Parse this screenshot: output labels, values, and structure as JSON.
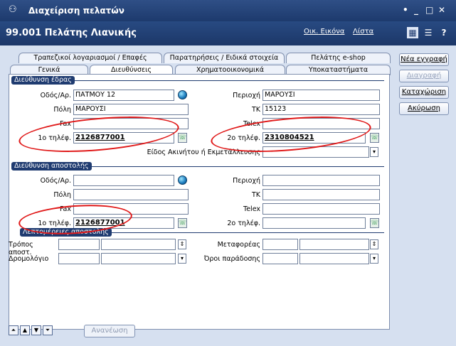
{
  "window": {
    "title": "Διαχείριση πελατών",
    "controls": [
      "•",
      "_",
      "□",
      "✕"
    ]
  },
  "header": {
    "title": "99.001 Πελάτης Λιανικής",
    "buttons": {
      "image": "Εικόνα",
      "list": "Λίστα"
    },
    "image_prefix": "Οικ."
  },
  "tabs_top": [
    "Τραπεζικοί λογαριασμοί / Επαφές",
    "Παρατηρήσεις / Ειδικά στοιχεία",
    "Πελάτης e-shop"
  ],
  "tabs_bottom": [
    "Γενικά",
    "Διευθύνσεις",
    "Χρηματοοικονομικά",
    "Υποκαταστήματα"
  ],
  "sections": {
    "seat": "Διεύθυνση έδρας",
    "shipping": "Διεύθυνση αποστολής",
    "shipping_details": "Λεπτομέρειες αποστολής"
  },
  "seat": {
    "street_label": "Οδός/Αρ.",
    "street_value": "ΠΑΤΜΟΥ 12",
    "area_label": "Περιοχή",
    "area_value": "ΜΑΡΟΥΣΙ",
    "city_label": "Πόλη",
    "city_value": "ΜΑΡΟΥΣΙ",
    "tk_label": "ΤΚ",
    "tk_value": "15123",
    "fax_label": "Fax",
    "telex_label": "Telex",
    "phone1_label": "1ο τηλέφ.",
    "phone1_value": "2126877001",
    "phone2_label": "2ο τηλέφ.",
    "phone2_value": "2310804521",
    "property_label": "Είδος Ακινήτου ή Εκμετάλλευσης"
  },
  "shipping": {
    "street_label": "Οδός/Αρ.",
    "area_label": "Περιοχή",
    "city_label": "Πόλη",
    "tk_label": "ΤΚ",
    "fax_label": "Fax",
    "telex_label": "Telex",
    "phone1_label": "1ο τηλέφ.",
    "phone1_value": "2126877001",
    "phone2_label": "2ο τηλέφ."
  },
  "details": {
    "method_label": "Τρόπος αποστ.",
    "carriers_label": "Μεταφορέας",
    "route_label": "Δρομολόγιο",
    "terms_label": "Όροι παράδοσης"
  },
  "actions": {
    "new": "Νέα εγγραφή",
    "delete": "Διαγραφή",
    "save": "Καταχώριση",
    "cancel": "Ακύρωση"
  },
  "footer": {
    "refresh": "Ανανέωση"
  },
  "colors": {
    "titlebar": "#1d3a6d",
    "highlight_oval": "#e01818",
    "panel_bg": "#d6e0f0"
  }
}
